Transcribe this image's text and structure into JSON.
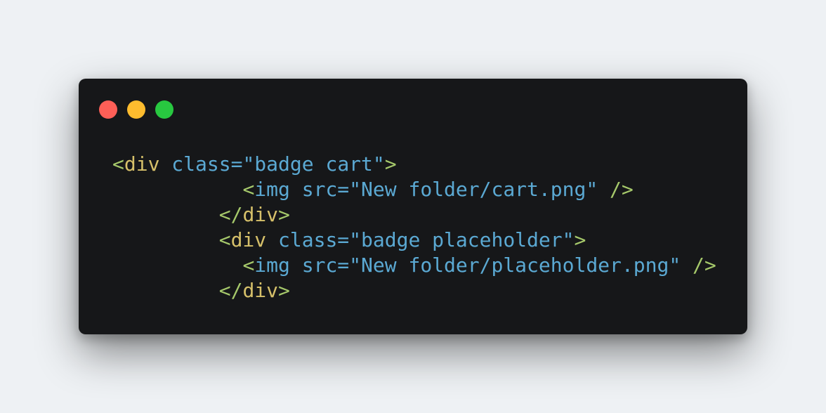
{
  "window": {
    "controls": [
      {
        "name": "close",
        "color": "#ff5f57"
      },
      {
        "name": "minimize",
        "color": "#febc2e"
      },
      {
        "name": "maximize",
        "color": "#28c840"
      }
    ]
  },
  "code": {
    "lines": [
      [
        {
          "t": "<",
          "k": "bracket"
        },
        {
          "t": "div",
          "k": "tag"
        },
        {
          "t": " class=",
          "k": "attr"
        },
        {
          "t": "\"badge cart\"",
          "k": "string"
        },
        {
          "t": ">",
          "k": "bracket"
        }
      ],
      [
        {
          "t": "           ",
          "k": "space"
        },
        {
          "t": "<",
          "k": "bracket"
        },
        {
          "t": "img",
          "k": "attr"
        },
        {
          "t": " src=",
          "k": "attr"
        },
        {
          "t": "\"New folder/cart.png\"",
          "k": "string"
        },
        {
          "t": " ",
          "k": "space"
        },
        {
          "t": "/>",
          "k": "bracket"
        }
      ],
      [
        {
          "t": "         ",
          "k": "space"
        },
        {
          "t": "</",
          "k": "bracket"
        },
        {
          "t": "div",
          "k": "tag"
        },
        {
          "t": ">",
          "k": "bracket"
        }
      ],
      [
        {
          "t": "         ",
          "k": "space"
        },
        {
          "t": "<",
          "k": "bracket"
        },
        {
          "t": "div",
          "k": "tag"
        },
        {
          "t": " class=",
          "k": "attr"
        },
        {
          "t": "\"badge placeholder\"",
          "k": "string"
        },
        {
          "t": ">",
          "k": "bracket"
        }
      ],
      [
        {
          "t": "           ",
          "k": "space"
        },
        {
          "t": "<",
          "k": "bracket"
        },
        {
          "t": "img",
          "k": "attr"
        },
        {
          "t": " src=",
          "k": "attr"
        },
        {
          "t": "\"New folder/placeholder.png\"",
          "k": "string"
        },
        {
          "t": " ",
          "k": "space"
        },
        {
          "t": "/>",
          "k": "bracket"
        }
      ],
      [
        {
          "t": "         ",
          "k": "space"
        },
        {
          "t": "</",
          "k": "bracket"
        },
        {
          "t": "div",
          "k": "tag"
        },
        {
          "t": ">",
          "k": "bracket"
        }
      ]
    ]
  }
}
